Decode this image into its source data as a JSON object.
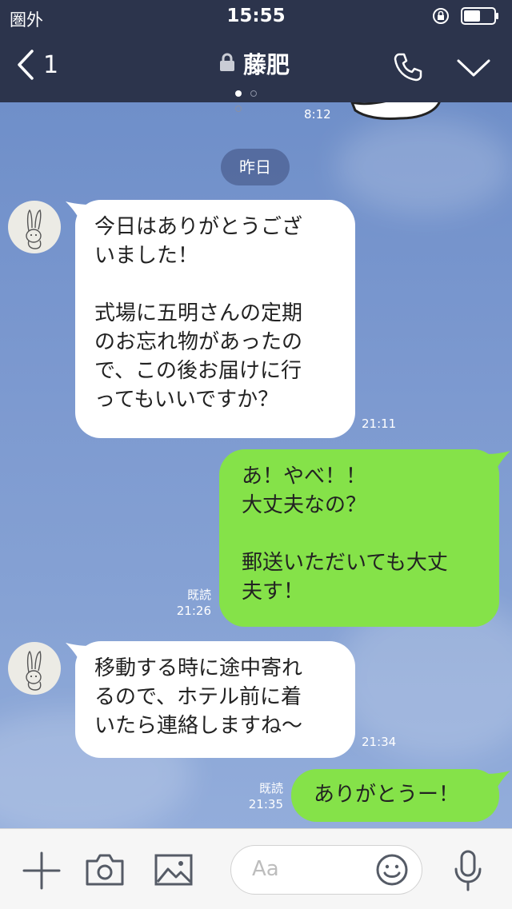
{
  "status_bar": {
    "carrier": "圏外",
    "time": "15:55"
  },
  "header": {
    "back_count": "1",
    "title": "藤肥"
  },
  "chat": {
    "top_time": "8:12",
    "date_separator": "昨日",
    "messages": [
      {
        "side": "in",
        "text": "今日はありがとうござ\nいました！\n\n式場に五明さんの定期\nのお忘れ物があったの\nで、この後お届けに行\nってもいいですか？",
        "time": "21:11"
      },
      {
        "side": "out",
        "text": "あ！やべ！！\n大丈夫なの？\n\n郵送いただいても大丈\n夫す！",
        "read": "既読",
        "time": "21:26"
      },
      {
        "side": "in",
        "text": "移動する時に途中寄れ\nるので、ホテル前に着\nいたら連絡しますね〜",
        "time": "21:34"
      },
      {
        "side": "out",
        "text": "ありがとうー！",
        "read": "既読",
        "time": "21:35"
      }
    ]
  },
  "input_bar": {
    "placeholder": "Aa"
  },
  "colors": {
    "header_bg": "#2c344c",
    "out_bubble": "#85e249",
    "in_bubble": "#ffffff",
    "chat_bg": "#7f9bd0"
  },
  "icons": [
    "back-chevron-icon",
    "lock-icon",
    "phone-icon",
    "chevron-down-icon",
    "plus-icon",
    "camera-icon",
    "image-icon",
    "emoji-icon",
    "microphone-icon"
  ]
}
